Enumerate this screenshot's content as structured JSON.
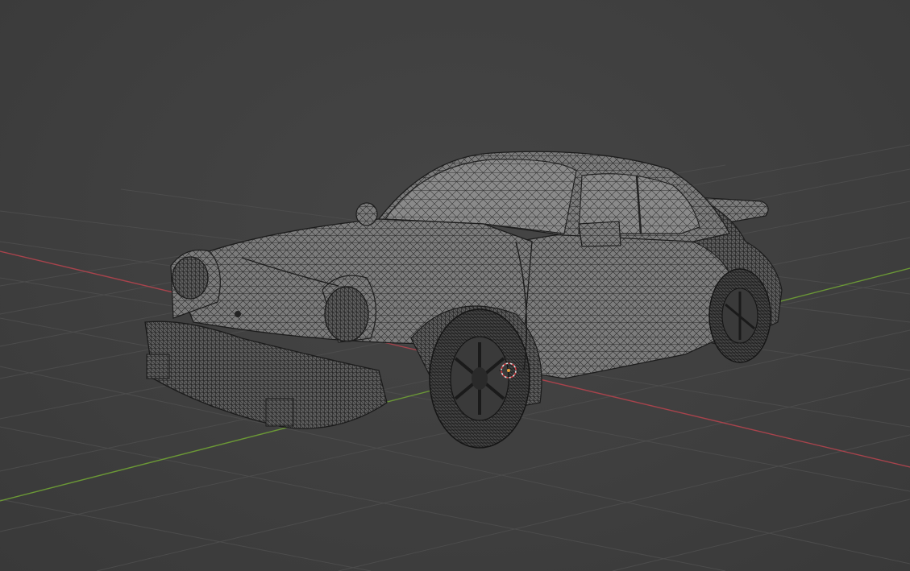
{
  "viewport": {
    "background": "#3d3d3d",
    "grid_color": "#4e4e4e",
    "x_axis_color": "#b0454f",
    "y_axis_color": "#6f9a3a",
    "mesh_fill": "#7a7a7a",
    "wire_color": "#1e1e1e",
    "object": "car-wireframe-mesh",
    "origin_marker": "3d-cursor-icon"
  }
}
